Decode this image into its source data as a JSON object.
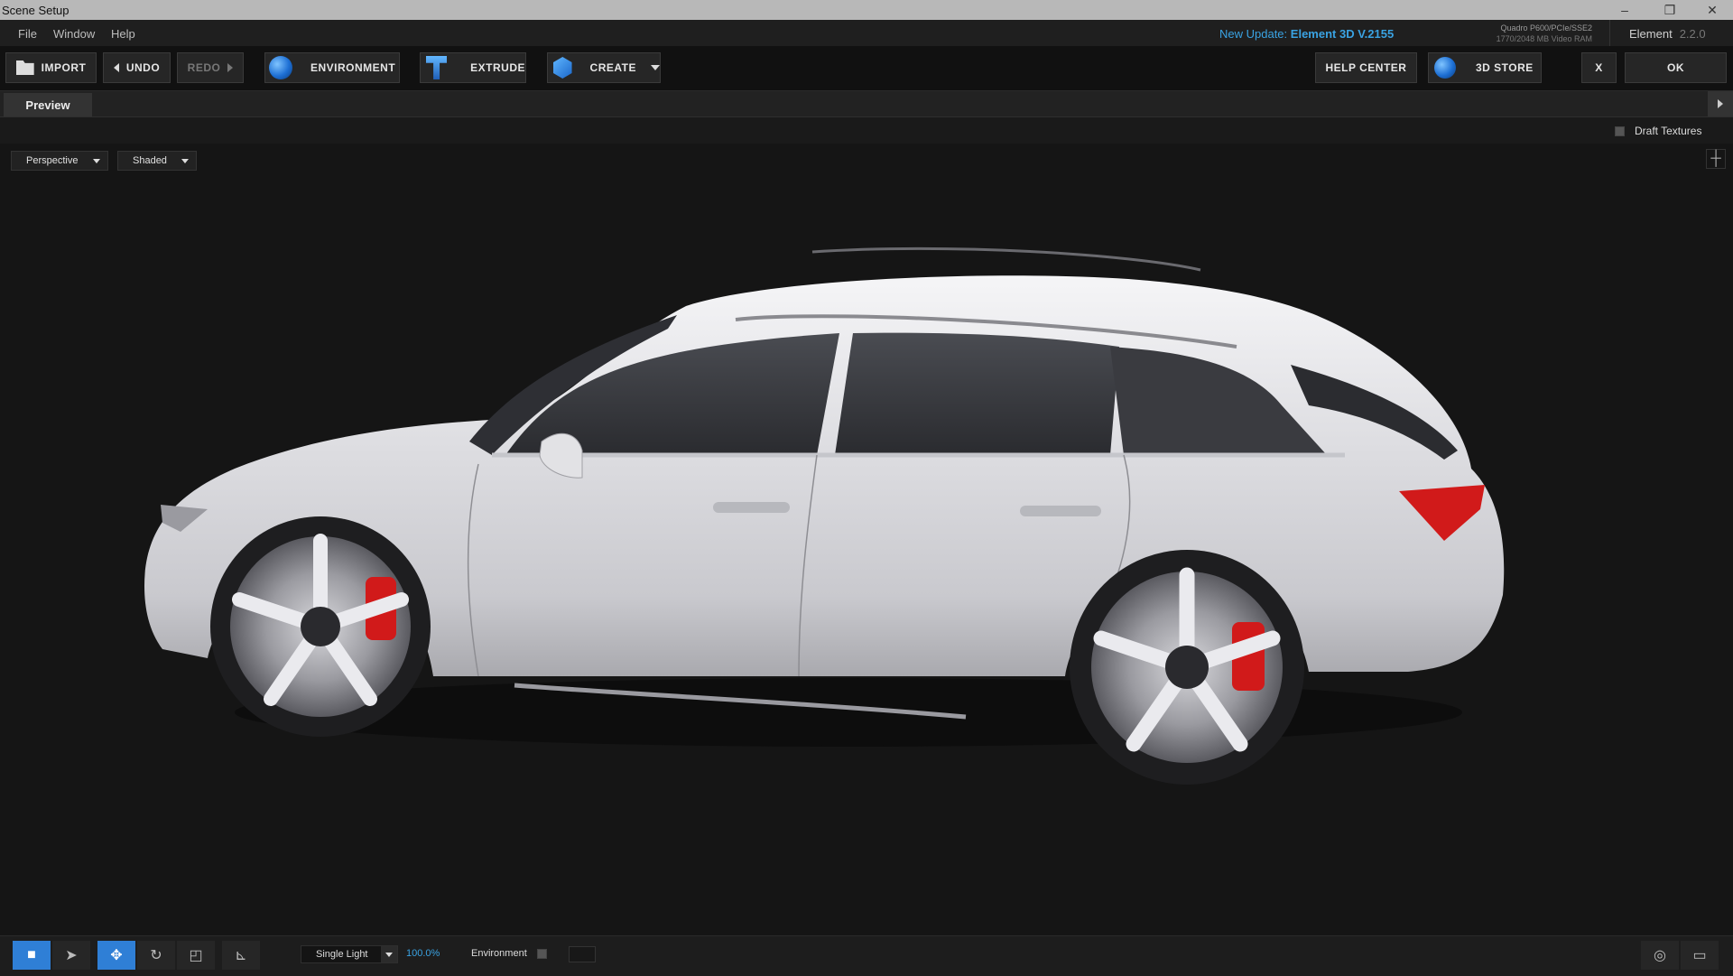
{
  "window": {
    "title": "Scene Setup"
  },
  "menu": [
    "File",
    "Window",
    "Help"
  ],
  "update": {
    "prefix": "New Update:",
    "version": "Element 3D V.2155"
  },
  "gpu": {
    "name": "Quadro P600/PCIe/SSE2",
    "vram": "1770/2048 MB Video RAM"
  },
  "app": {
    "name": "Element",
    "version": "2.2.0"
  },
  "toolbar": {
    "import": "IMPORT",
    "undo": "UNDO",
    "redo": "REDO",
    "environment": "ENVIRONMENT",
    "extrude": "EXTRUDE",
    "create": "CREATE",
    "help_center": "HELP CENTER",
    "store": "3D STORE",
    "close": "X",
    "ok": "OK"
  },
  "tabs": [
    "Preview"
  ],
  "options": {
    "draft_textures": "Draft Textures",
    "draft_checked": false
  },
  "viewport": {
    "camera": "Perspective",
    "shading": "Shaded"
  },
  "bottom": {
    "light": "Single Light",
    "intensity": "100.0%",
    "environment": "Environment"
  },
  "colors": {
    "accent": "#2f7fd6",
    "link": "#3aa3e3",
    "caliper": "#d11a1a",
    "body": "#e4e4e6"
  },
  "icons": {
    "import": "folder-icon",
    "undo": "arrow-left-icon",
    "redo": "arrow-right-icon",
    "environment": "globe-icon",
    "extrude": "extrude-icon",
    "create": "cube-icon",
    "store": "globe-icon",
    "camera": "camera-icon",
    "select": "pointer-icon",
    "move": "move-icon",
    "rotate": "rotate-icon",
    "scale": "scale-icon",
    "axis": "axis-icon",
    "target": "target-icon",
    "monitor": "monitor-icon"
  }
}
